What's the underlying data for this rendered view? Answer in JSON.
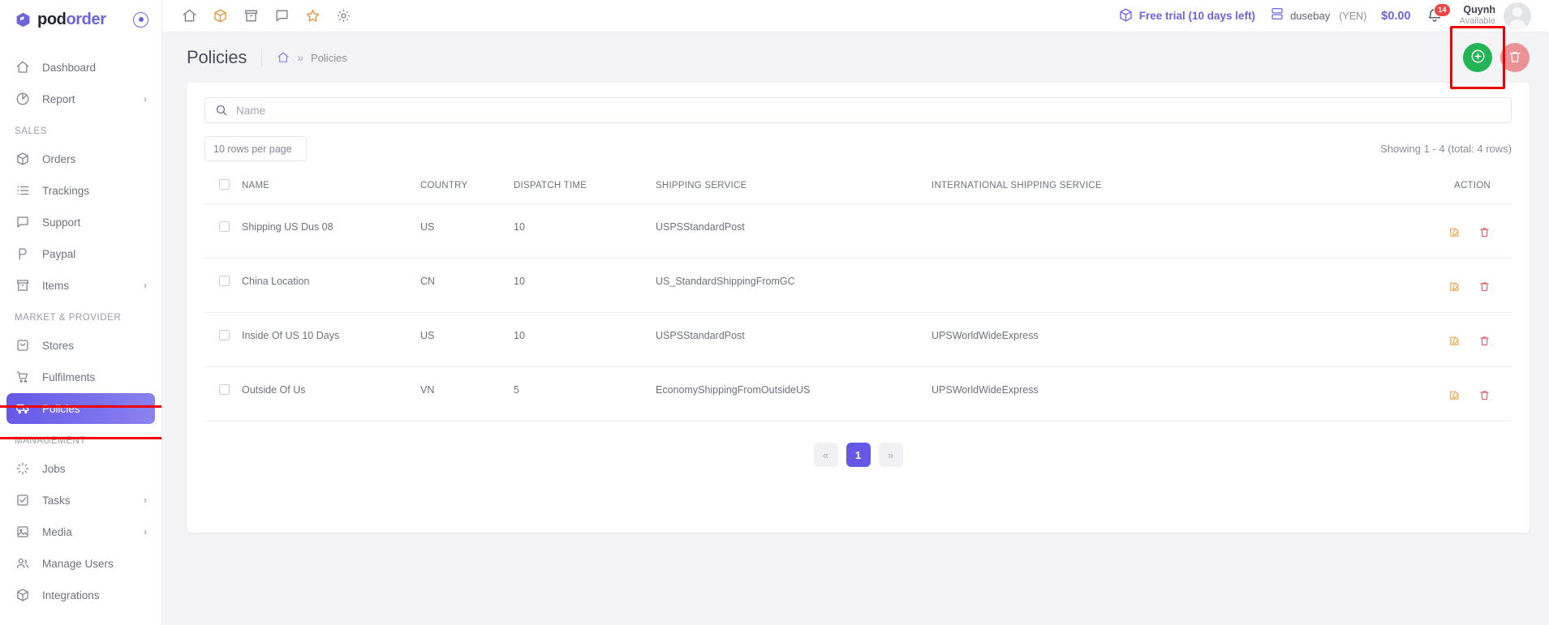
{
  "brand": {
    "name_part1": "pod",
    "name_part2": "order",
    "collapse_icon": "circle-dot-icon"
  },
  "sidebar": {
    "items": [
      {
        "label": "Dashboard",
        "icon": "home-icon",
        "chevron": "",
        "active": false
      },
      {
        "label": "Report",
        "icon": "pie-chart-icon",
        "chevron": "›",
        "active": false
      }
    ],
    "section_sales": "SALES",
    "sales_items": [
      {
        "label": "Orders",
        "icon": "package-icon",
        "chevron": ""
      },
      {
        "label": "Trackings",
        "icon": "list-icon",
        "chevron": ""
      },
      {
        "label": "Support",
        "icon": "chat-icon",
        "chevron": ""
      },
      {
        "label": "Paypal",
        "icon": "paypal-p-icon",
        "chevron": ""
      },
      {
        "label": "Items",
        "icon": "archive-icon",
        "chevron": "›"
      }
    ],
    "section_market": "MARKET & PROVIDER",
    "market_items": [
      {
        "label": "Stores",
        "icon": "store-icon",
        "chevron": ""
      },
      {
        "label": "Fulfilments",
        "icon": "cart-icon",
        "chevron": ""
      },
      {
        "label": "Policies",
        "icon": "truck-icon",
        "chevron": "",
        "active": true
      }
    ],
    "section_management": "MANAGEMENT",
    "management_items": [
      {
        "label": "Jobs",
        "icon": "spinner-icon",
        "chevron": ""
      },
      {
        "label": "Tasks",
        "icon": "task-check-icon",
        "chevron": "›"
      },
      {
        "label": "Media",
        "icon": "image-icon",
        "chevron": "›"
      },
      {
        "label": "Manage Users",
        "icon": "users-icon",
        "chevron": ""
      },
      {
        "label": "Integrations",
        "icon": "box-3d-icon",
        "chevron": ""
      }
    ]
  },
  "topbar": {
    "icons": [
      {
        "name": "home-icon",
        "color": "#7a7d8a"
      },
      {
        "name": "package-icon",
        "color": "#e8913a"
      },
      {
        "name": "archive-icon",
        "color": "#7a7d8a"
      },
      {
        "name": "chat-icon",
        "color": "#7a7d8a"
      },
      {
        "name": "star-icon",
        "color": "#e8913a"
      },
      {
        "name": "gear-icon",
        "color": "#7a7d8a"
      }
    ],
    "trial_label": "Free trial (10 days left)",
    "trial_icon": "package-icon",
    "store_icon": "server-icon",
    "store_name": "dusebay",
    "store_currency": "(YEN)",
    "balance": "$0.00",
    "bell_icon": "bell-icon",
    "notification_count": "14",
    "user_name": "Quynh",
    "user_status": "Available",
    "avatar": "user-avatar"
  },
  "page": {
    "title": "Policies",
    "breadcrumb_home_icon": "home-icon",
    "breadcrumb_separator": "»",
    "breadcrumb_current": "Policies",
    "add_button_icon": "plus-circle-icon",
    "delete_button_icon": "trash-icon",
    "accent_add": "#22b455",
    "accent_delete": "#eb9297",
    "annotation_color": "#ef0000"
  },
  "search": {
    "placeholder": "Name",
    "value": "",
    "icon": "search-icon"
  },
  "controls": {
    "rows_per_page": "10 rows per page",
    "showing": "Showing 1 - 4 (total: 4 rows)"
  },
  "table": {
    "columns": [
      "NAME",
      "COUNTRY",
      "DISPATCH TIME",
      "SHIPPING SERVICE",
      "INTERNATIONAL SHIPPING SERVICE",
      "ACTION"
    ],
    "rows": [
      {
        "name": "Shipping US Dus 08",
        "country": "US",
        "dispatch_time": "10",
        "shipping_service": "USPSStandardPost",
        "international_shipping_service": ""
      },
      {
        "name": "China Location",
        "country": "CN",
        "dispatch_time": "10",
        "shipping_service": "US_StandardShippingFromGC",
        "international_shipping_service": ""
      },
      {
        "name": "Inside Of US 10 Days",
        "country": "US",
        "dispatch_time": "10",
        "shipping_service": "USPSStandardPost",
        "international_shipping_service": "UPSWorldWideExpress"
      },
      {
        "name": "Outside Of Us",
        "country": "VN",
        "dispatch_time": "5",
        "shipping_service": "EconomyShippingFromOutsideUS",
        "international_shipping_service": "UPSWorldWideExpress"
      }
    ],
    "row_action_edit_icon": "edit-pencil-icon",
    "row_action_delete_icon": "trash-icon"
  },
  "pagination": {
    "prev": "«",
    "pages": [
      "1"
    ],
    "next": "»",
    "current": "1"
  }
}
